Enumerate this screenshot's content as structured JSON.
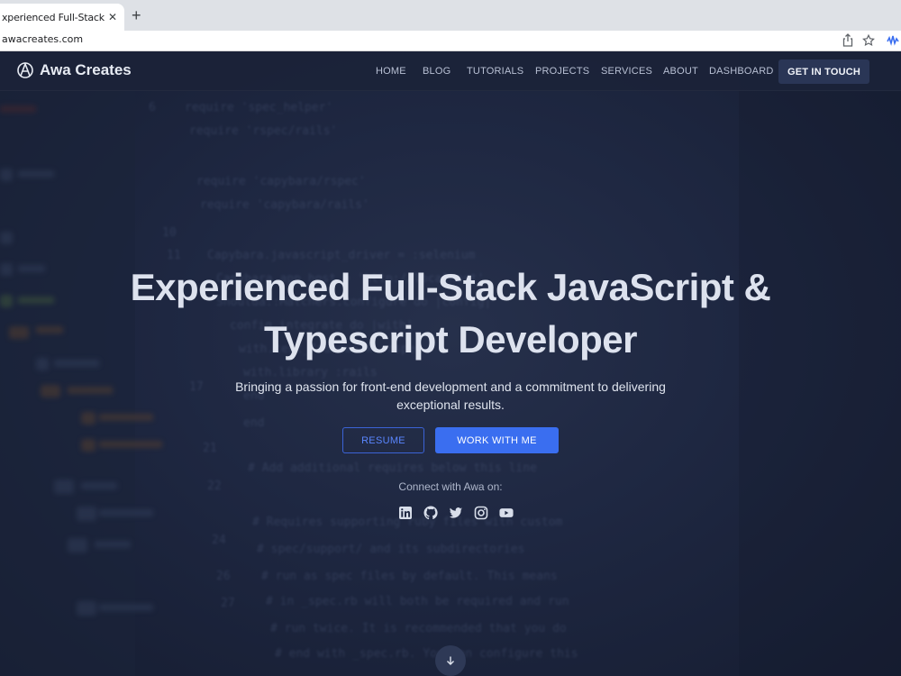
{
  "browser": {
    "tab_title": "xperienced Full-Stack JavaSc",
    "tab_close": "✕",
    "new_tab": "+",
    "url": "awacreates.com",
    "share_icon": "share-icon",
    "bookmark_icon": "star-icon",
    "extension_icon": "extension-icon"
  },
  "nav": {
    "brand": "Awa Creates",
    "links": [
      "HOME",
      "BLOG",
      "TUTORIALS",
      "PROJECTS",
      "SERVICES",
      "ABOUT",
      "DASHBOARD"
    ],
    "cta": "GET IN TOUCH"
  },
  "hero": {
    "title_line1": "Experienced Full-Stack JavaScript &",
    "title_line2": "Typescript Developer",
    "subtitle": "Bringing a passion for front-end development and a commitment to delivering exceptional results.",
    "resume_label": "RESUME",
    "work_label": "WORK WITH ME",
    "connect_label": "Connect with Awa on:",
    "socials": [
      "linkedin-icon",
      "github-icon",
      "twitter-icon",
      "instagram-icon",
      "youtube-icon"
    ]
  },
  "colors": {
    "background": "#1e2741",
    "navbar": "#1b2338",
    "accent": "#3a6ef0",
    "cta_bg": "#2a3656"
  }
}
